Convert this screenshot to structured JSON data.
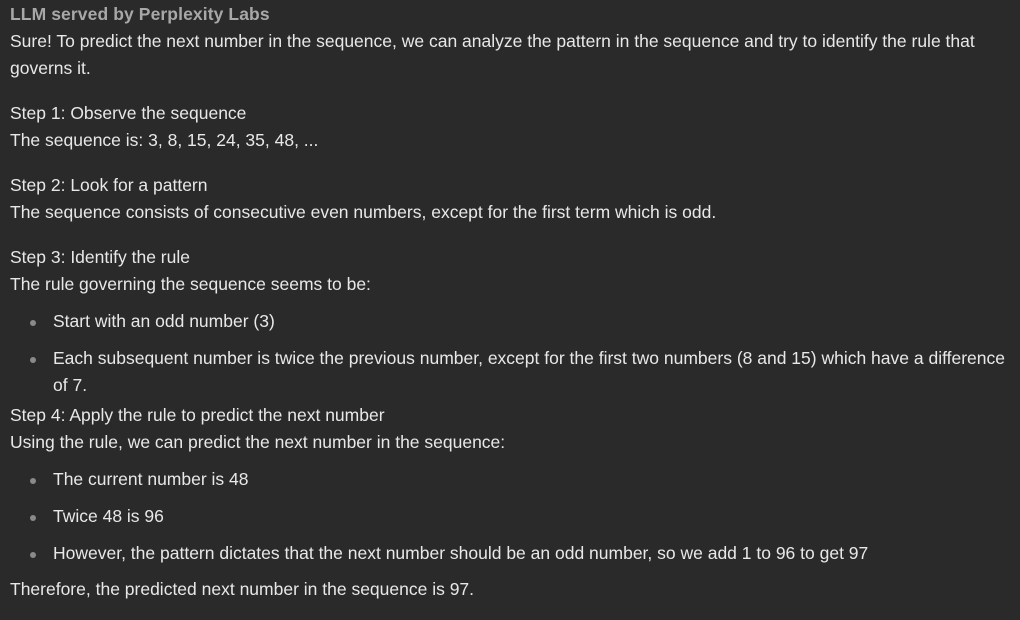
{
  "header": {
    "label": "LLM served by Perplexity Labs"
  },
  "response": {
    "intro": "Sure! To predict the next number in the sequence, we can analyze the pattern in the sequence and try to identify the rule that governs it.",
    "step1": {
      "title": "Step 1: Observe the sequence",
      "body": "The sequence is: 3, 8, 15, 24, 35, 48, ..."
    },
    "step2": {
      "title": "Step 2: Look for a pattern",
      "body": "The sequence consists of consecutive even numbers, except for the first term which is odd."
    },
    "step3": {
      "title": "Step 3: Identify the rule",
      "body": "The rule governing the sequence seems to be:",
      "bullets": [
        "Start with an odd number (3)",
        "Each subsequent number is twice the previous number, except for the first two numbers (8 and 15) which have a difference of 7."
      ]
    },
    "step4": {
      "title": "Step 4: Apply the rule to predict the next number",
      "body": "Using the rule, we can predict the next number in the sequence:",
      "bullets": [
        "The current number is 48",
        "Twice 48 is 96",
        "However, the pattern dictates that the next number should be an odd number, so we add 1 to 96 to get 97"
      ]
    },
    "conclusion": "Therefore, the predicted next number in the sequence is 97."
  }
}
